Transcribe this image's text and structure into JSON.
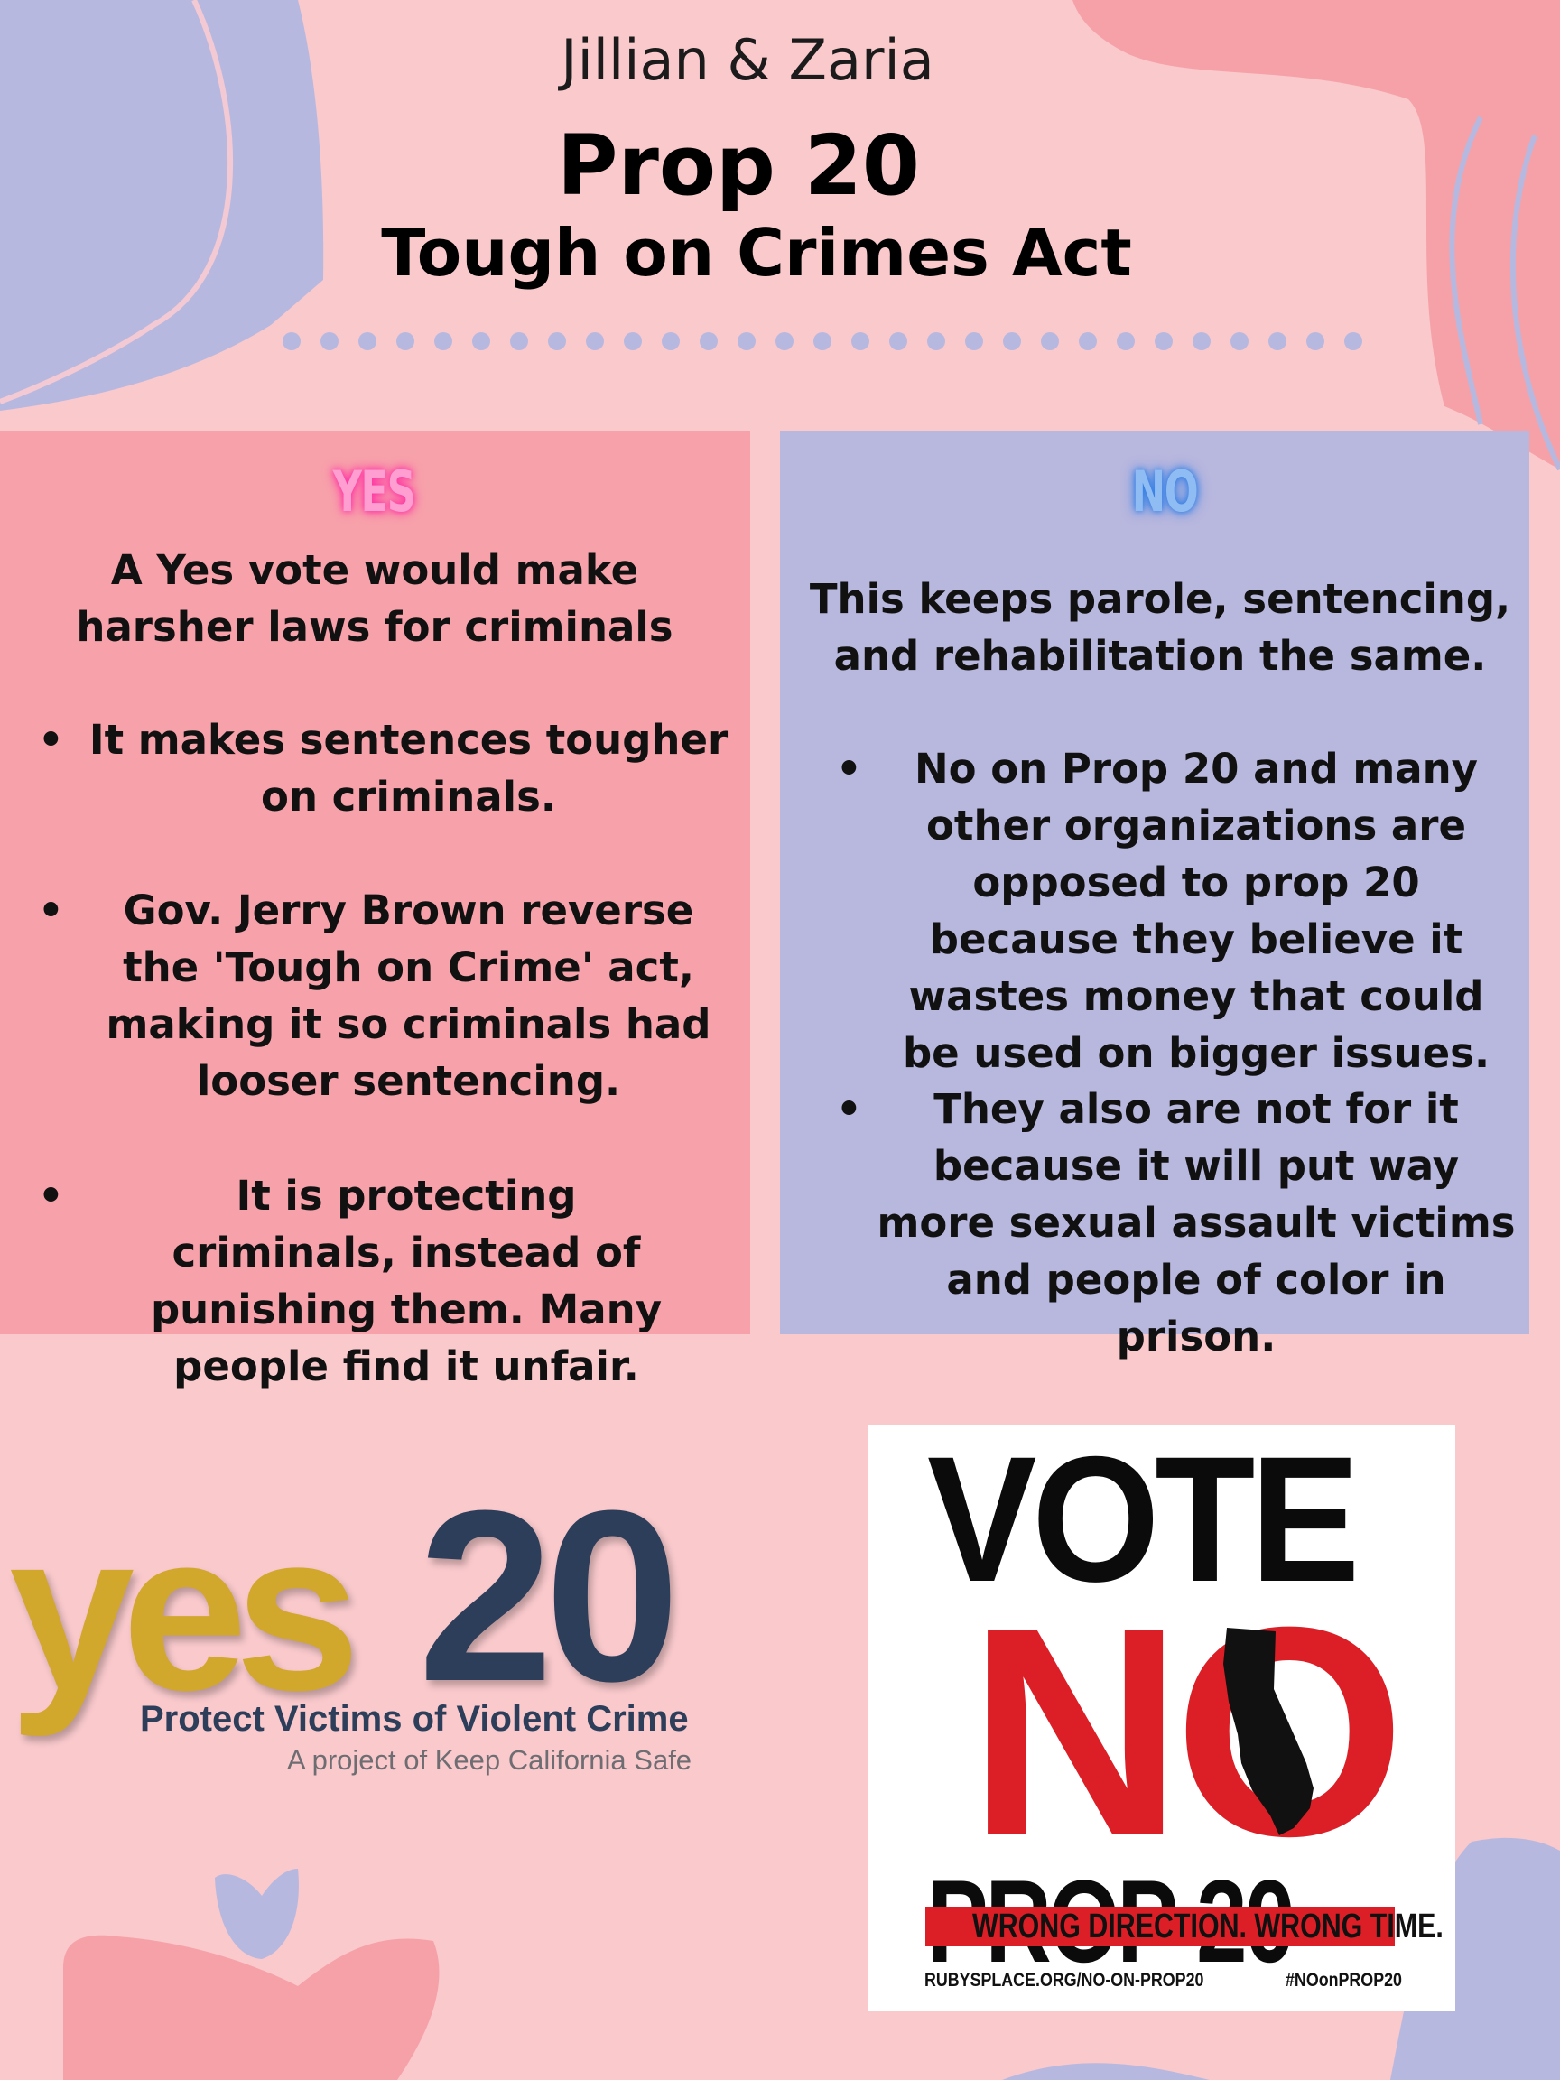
{
  "header": {
    "authors": "Jillian & Zaria",
    "title": "Prop 20",
    "subtitle": "Tough on Crimes Act"
  },
  "yes_panel": {
    "heading": "YES",
    "intro": "A Yes vote would make harsher laws for criminals",
    "bullets": [
      "It makes sentences tougher on criminals.",
      "Gov. Jerry Brown reverse the 'Tough on Crime' act, making it so criminals had looser sentencing.",
      "It is protecting criminals, instead of punishing them. Many people find it unfair."
    ]
  },
  "no_panel": {
    "heading": "NO",
    "intro": "This keeps parole, sentencing, and rehabilitation the same.",
    "bullets": [
      "No on Prop 20 and many other organizations are opposed to prop 20 because they believe it wastes money that could be used on bigger issues.",
      "They also are not for it because it will put way more sexual assault victims and people of color in prison."
    ]
  },
  "yes_logo": {
    "word": "yes",
    "number": "20",
    "tagline": "Protect Victims of Violent Crime",
    "sub": "A project of Keep California Safe"
  },
  "vote_no_sign": {
    "line1": "VOTE",
    "line2": "NO",
    "line3": "PROP 20",
    "banner": "WRONG DIRECTION. WRONG TIME.",
    "url": "RUBYSPLACE.ORG/NO-ON-PROP20",
    "hashtag": "#NOonPROP20"
  },
  "colors": {
    "background": "#f9c9cc",
    "yes_panel": "#f7a2aa",
    "no_panel": "#b8b7de",
    "lavender": "#b7b8df",
    "coral": "#f6a1a8",
    "yes_gold": "#d1a72c",
    "yes_navy": "#2c3e5a",
    "sign_red": "#dc1f26"
  }
}
